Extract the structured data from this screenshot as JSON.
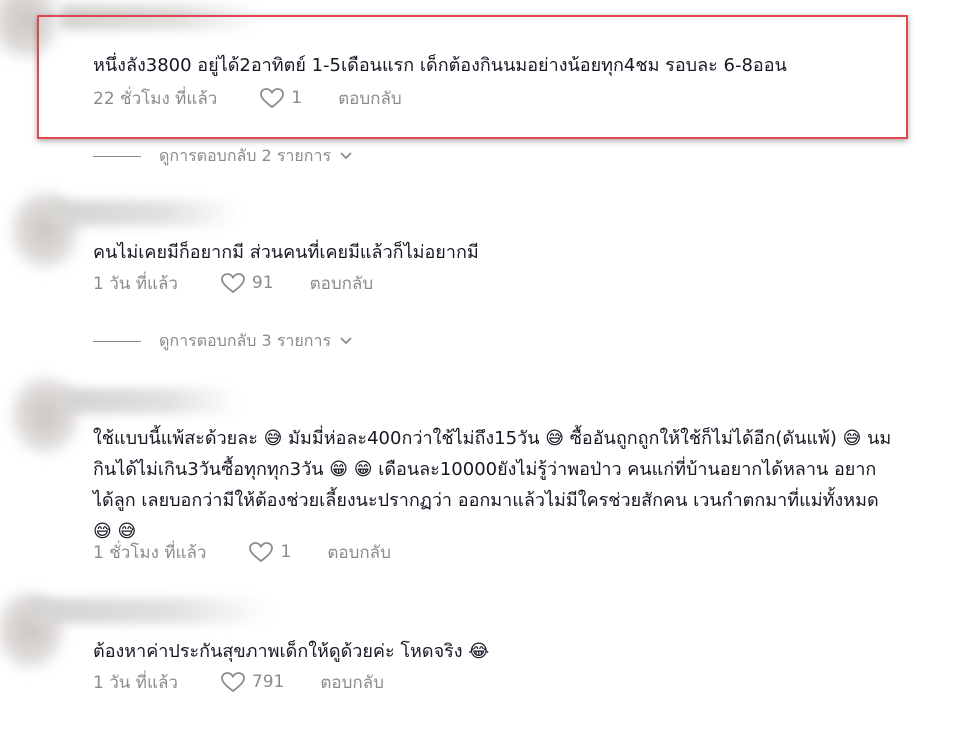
{
  "comments": [
    {
      "text": "หนึ่งลัง3800 อยู่ได้2อาทิตย์ 1-5เดือนแรก เด็กต้องกินนมอย่างน้อยทุก4ชม รอบละ 6-8ออน",
      "time": "22 ชั่วโมง ที่แล้ว",
      "likes": "1",
      "reply": "ตอบกลับ",
      "view_replies": "ดูการตอบกลับ 2 รายการ"
    },
    {
      "text": "คนไม่เคยมีก็อยากมี ส่วนคนที่เคยมีแล้วก็ไม่อยากมี",
      "time": "1 วัน ที่แล้ว",
      "likes": "91",
      "reply": "ตอบกลับ",
      "view_replies": "ดูการตอบกลับ 3 รายการ"
    },
    {
      "lines": [
        "ใช้แบบนี้แพ้สะด้วยละ 😅 มัมมี่ห่อละ400กว่าใช้ไม่ถึง15วัน 😅 ซื้ออันถูกถูกให้ใช้ก็ไม่ได้อีก(ดันแพ้) 😅 นม",
        "กินได้ไม่เกิน3วันซื้อทุกทุก3วัน 😁 😁 เดือนละ10000ยังไม่รู้ว่าพอป่าว คนแก่ที่บ้านอยากได้หลาน อยาก",
        "ได้ลูก เลยบอกว่ามีให้ต้องช่วยเลี้ยงนะปรากฏว่า ออกมาแล้วไม่มีใครช่วยสักคน เวนกำตกมาที่แม่ทั้งหมด",
        "😅 😅"
      ],
      "time": "1 ชั่วโมง ที่แล้ว",
      "likes": "1",
      "reply": "ตอบกลับ"
    },
    {
      "text": "ต้องหาค่าประกันสุขภาพเด็กให้ดูด้วยค่ะ โหดจริง 😂",
      "time": "1 วัน ที่แล้ว",
      "likes": "791",
      "reply": "ตอบกลับ"
    }
  ],
  "icons": {
    "like": "heart-outline-icon",
    "expand": "chevron-down-icon"
  },
  "colors": {
    "highlight_border": "#e0474c",
    "text": "#161823",
    "meta": "#8a8b91"
  }
}
